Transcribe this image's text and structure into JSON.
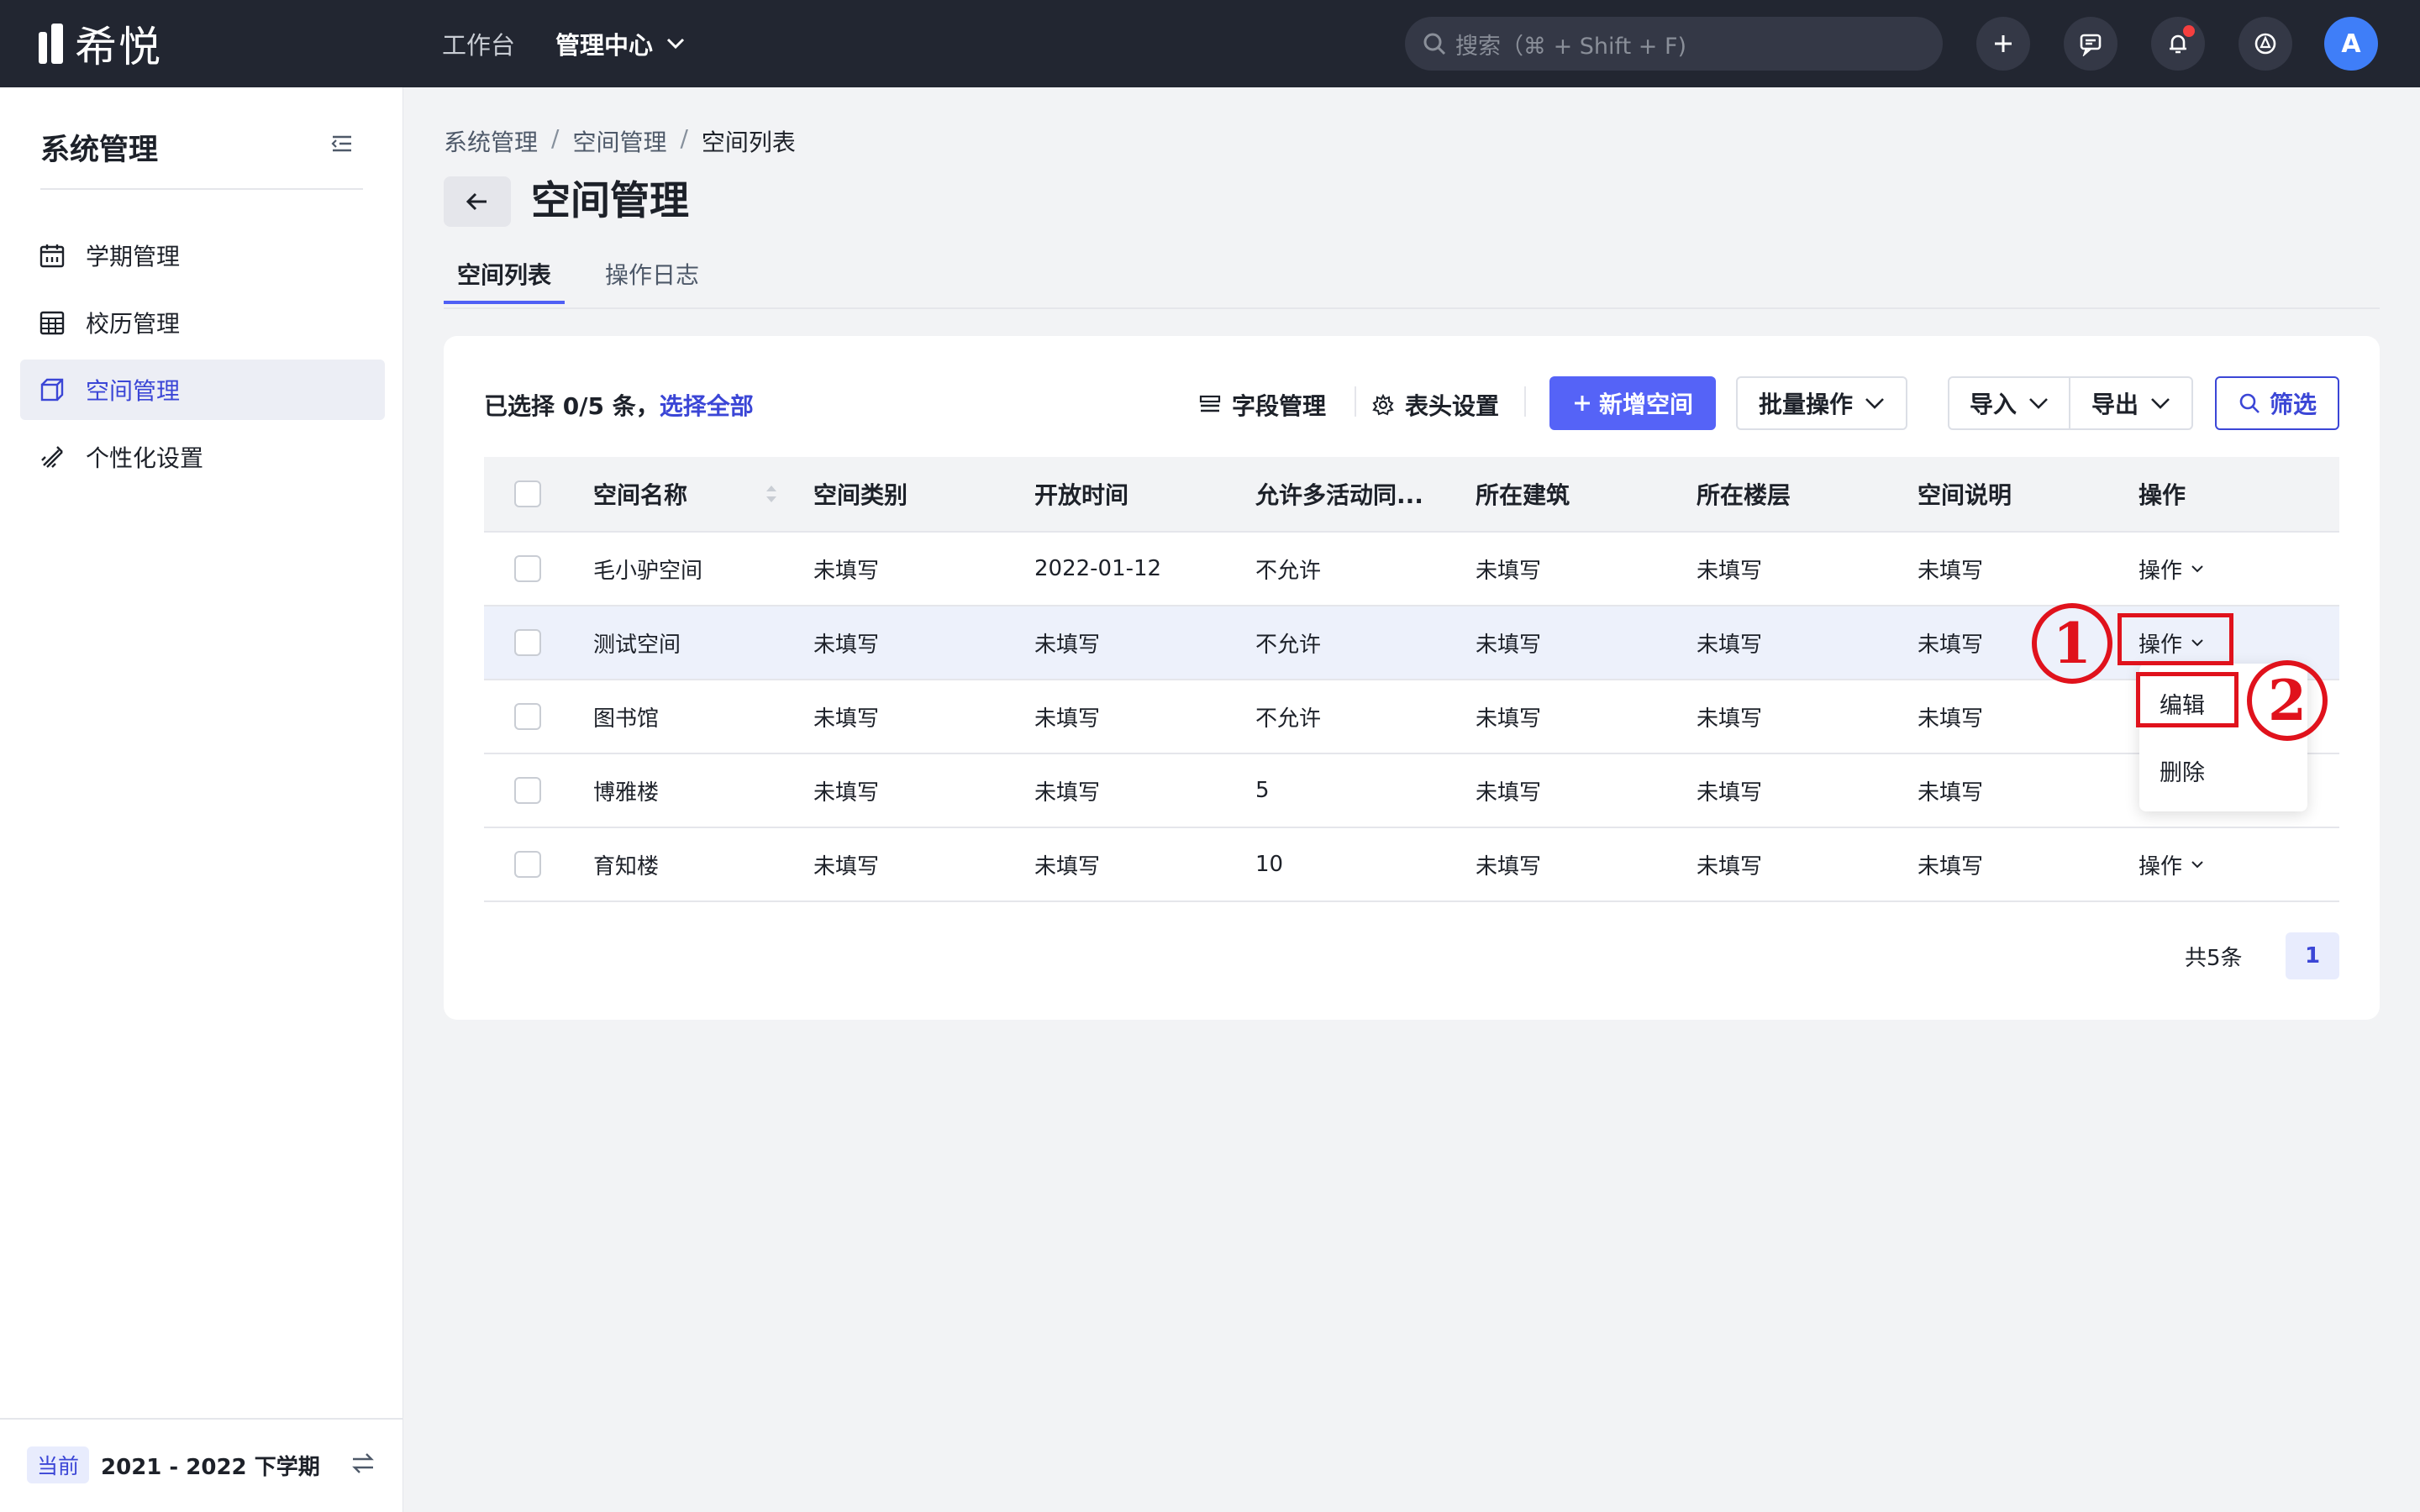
{
  "app": {
    "logo_text": "希悦"
  },
  "topnav": {
    "workbench": "工作台",
    "admin_center": "管理中心"
  },
  "search": {
    "placeholder": "搜索（⌘ + Shift + F)"
  },
  "user": {
    "avatar_initial": "A"
  },
  "sidebar": {
    "title": "系统管理",
    "items": [
      {
        "label": "学期管理",
        "icon": "calendar-icon"
      },
      {
        "label": "校历管理",
        "icon": "calendar-grid-icon"
      },
      {
        "label": "空间管理",
        "icon": "cube-icon",
        "active": true
      },
      {
        "label": "个性化设置",
        "icon": "brush-icon"
      }
    ],
    "term_badge": "当前",
    "term_name": "2021 - 2022 下学期"
  },
  "breadcrumb": [
    "系统管理",
    "空间管理",
    "空间列表"
  ],
  "page": {
    "title": "空间管理"
  },
  "tabs": [
    {
      "label": "空间列表",
      "active": true
    },
    {
      "label": "操作日志"
    }
  ],
  "toolbar": {
    "selected_prefix": "已选择 0/5 条，",
    "select_all": "选择全部",
    "field_manage": "字段管理",
    "header_settings": "表头设置",
    "add_space": "新增空间",
    "batch_ops": "批量操作",
    "import": "导入",
    "export": "导出",
    "filter": "筛选"
  },
  "table": {
    "columns": [
      "空间名称",
      "空间类别",
      "开放时间",
      "允许多活动同...",
      "所在建筑",
      "所在楼层",
      "空间说明",
      "操作"
    ],
    "rows": [
      [
        "毛小驴空间",
        "未填写",
        "2022-01-12",
        "不允许",
        "未填写",
        "未填写",
        "未填写",
        "操作"
      ],
      [
        "测试空间",
        "未填写",
        "未填写",
        "不允许",
        "未填写",
        "未填写",
        "未填写",
        "操作"
      ],
      [
        "图书馆",
        "未填写",
        "未填写",
        "不允许",
        "未填写",
        "未填写",
        "未填写",
        ""
      ],
      [
        "博雅楼",
        "未填写",
        "未填写",
        "5",
        "未填写",
        "未填写",
        "未填写",
        ""
      ],
      [
        "育知楼",
        "未填写",
        "未填写",
        "10",
        "未填写",
        "未填写",
        "未填写",
        "操作"
      ]
    ]
  },
  "dropdown": {
    "items": [
      "编辑",
      "删除"
    ]
  },
  "pagination": {
    "total": "共5条",
    "current_page": "1"
  },
  "annotations": {
    "step1": "1",
    "step2": "2"
  },
  "colors": {
    "primary": "#5563f7",
    "link": "#3b46d6",
    "annotation": "#e0121c",
    "topbar": "#222631"
  }
}
